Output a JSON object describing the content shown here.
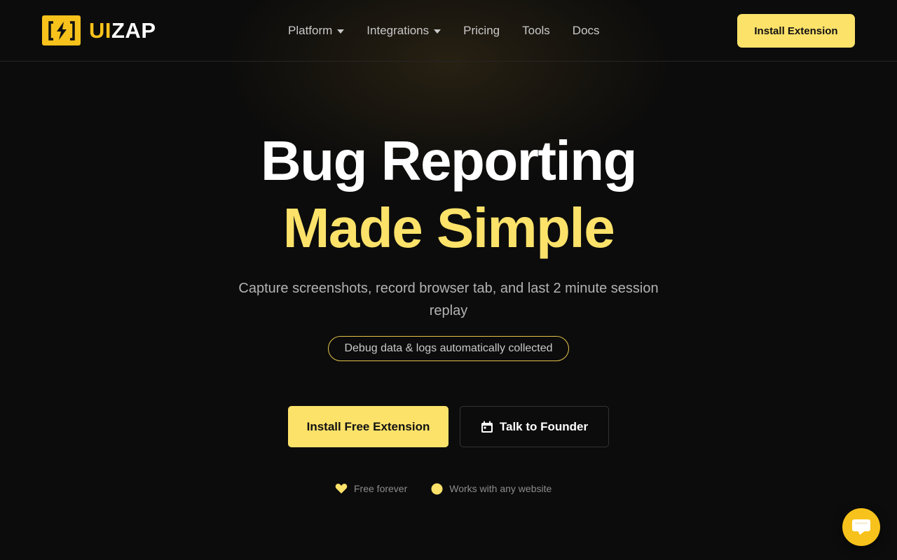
{
  "brand": {
    "logo_ui": "UI",
    "logo_zap": "ZAP",
    "accent_color": "#fde26a",
    "logo_color": "#f7c21b"
  },
  "nav": {
    "items": [
      {
        "label": "Platform",
        "has_dropdown": true
      },
      {
        "label": "Integrations",
        "has_dropdown": true
      },
      {
        "label": "Pricing",
        "has_dropdown": false
      },
      {
        "label": "Tools",
        "has_dropdown": false
      },
      {
        "label": "Docs",
        "has_dropdown": false
      }
    ],
    "cta_label": "Install Extension"
  },
  "hero": {
    "title_line1": "Bug Reporting",
    "title_line2": "Made Simple",
    "subtitle": "Capture screenshots, record browser tab, and last 2 minute session replay",
    "pill": "Debug data & logs automatically collected",
    "primary_cta": "Install Free Extension",
    "secondary_cta": "Talk to Founder",
    "secondary_cta_icon": "calendar-icon",
    "features": [
      {
        "label": "Free forever",
        "icon": "heart-icon"
      },
      {
        "label": "Works with any website",
        "icon": "circle-icon"
      }
    ]
  },
  "chat": {
    "icon": "chat-icon"
  }
}
